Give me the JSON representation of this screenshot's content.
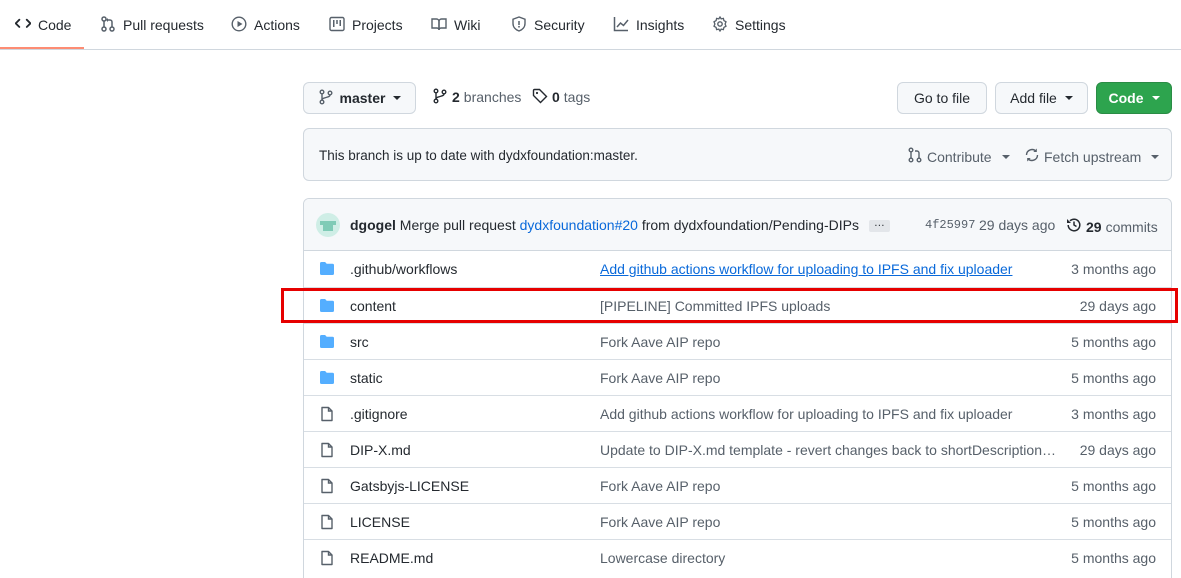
{
  "nav": {
    "tabs": [
      {
        "label": "Code",
        "icon": "code-icon"
      },
      {
        "label": "Pull requests",
        "icon": "git-pull-request-icon"
      },
      {
        "label": "Actions",
        "icon": "play-icon"
      },
      {
        "label": "Projects",
        "icon": "table-icon"
      },
      {
        "label": "Wiki",
        "icon": "book-icon"
      },
      {
        "label": "Security",
        "icon": "shield-icon"
      },
      {
        "label": "Insights",
        "icon": "graph-icon"
      },
      {
        "label": "Settings",
        "icon": "gear-icon"
      }
    ],
    "active": "Code"
  },
  "toolbar": {
    "branch": "master",
    "branches_count": "2",
    "branches_label": "branches",
    "tags_count": "0",
    "tags_label": "tags",
    "go_to_file": "Go to file",
    "add_file": "Add file",
    "code": "Code"
  },
  "upstream": {
    "message": "This branch is up to date with dydxfoundation:master.",
    "contribute": "Contribute",
    "fetch_upstream": "Fetch upstream"
  },
  "latest_commit": {
    "author": "dgogel",
    "message_prefix": "Merge pull request",
    "pr_link": "dydxfoundation#20",
    "message_suffix": "from dydxfoundation/Pending-DIPs",
    "ellipsis": "…",
    "sha": "4f25997",
    "age": "29 days ago",
    "commits_count": "29",
    "commits_label": "commits"
  },
  "files": [
    {
      "type": "dir",
      "name": ".github/workflows",
      "message": "Add github actions workflow for uploading to IPFS and fix uploader",
      "age": "3 months ago",
      "message_underlined": true
    },
    {
      "type": "dir",
      "name": "content",
      "message": "[PIPELINE] Committed IPFS uploads",
      "age": "29 days ago",
      "message_underlined": false
    },
    {
      "type": "dir",
      "name": "src",
      "message": "Fork Aave AIP repo",
      "age": "5 months ago",
      "message_underlined": false
    },
    {
      "type": "dir",
      "name": "static",
      "message": "Fork Aave AIP repo",
      "age": "5 months ago",
      "message_underlined": false
    },
    {
      "type": "file",
      "name": ".gitignore",
      "message": "Add github actions workflow for uploading to IPFS and fix uploader",
      "age": "3 months ago",
      "message_underlined": false
    },
    {
      "type": "file",
      "name": "DIP-X.md",
      "message": "Update to DIP-X.md template - revert changes back to shortDescription…",
      "age": "29 days ago",
      "message_underlined": false
    },
    {
      "type": "file",
      "name": "Gatsbyjs-LICENSE",
      "message": "Fork Aave AIP repo",
      "age": "5 months ago",
      "message_underlined": false
    },
    {
      "type": "file",
      "name": "LICENSE",
      "message": "Fork Aave AIP repo",
      "age": "5 months ago",
      "message_underlined": false
    },
    {
      "type": "file",
      "name": "README.md",
      "message": "Lowercase directory",
      "age": "5 months ago",
      "message_underlined": false
    }
  ],
  "highlighted_row": "content",
  "colors": {
    "folder": "#54aeff",
    "link": "#0969da",
    "green_button": "#2da44e",
    "highlight": "#e60000",
    "active_tab_underline": "#fd8c73"
  }
}
